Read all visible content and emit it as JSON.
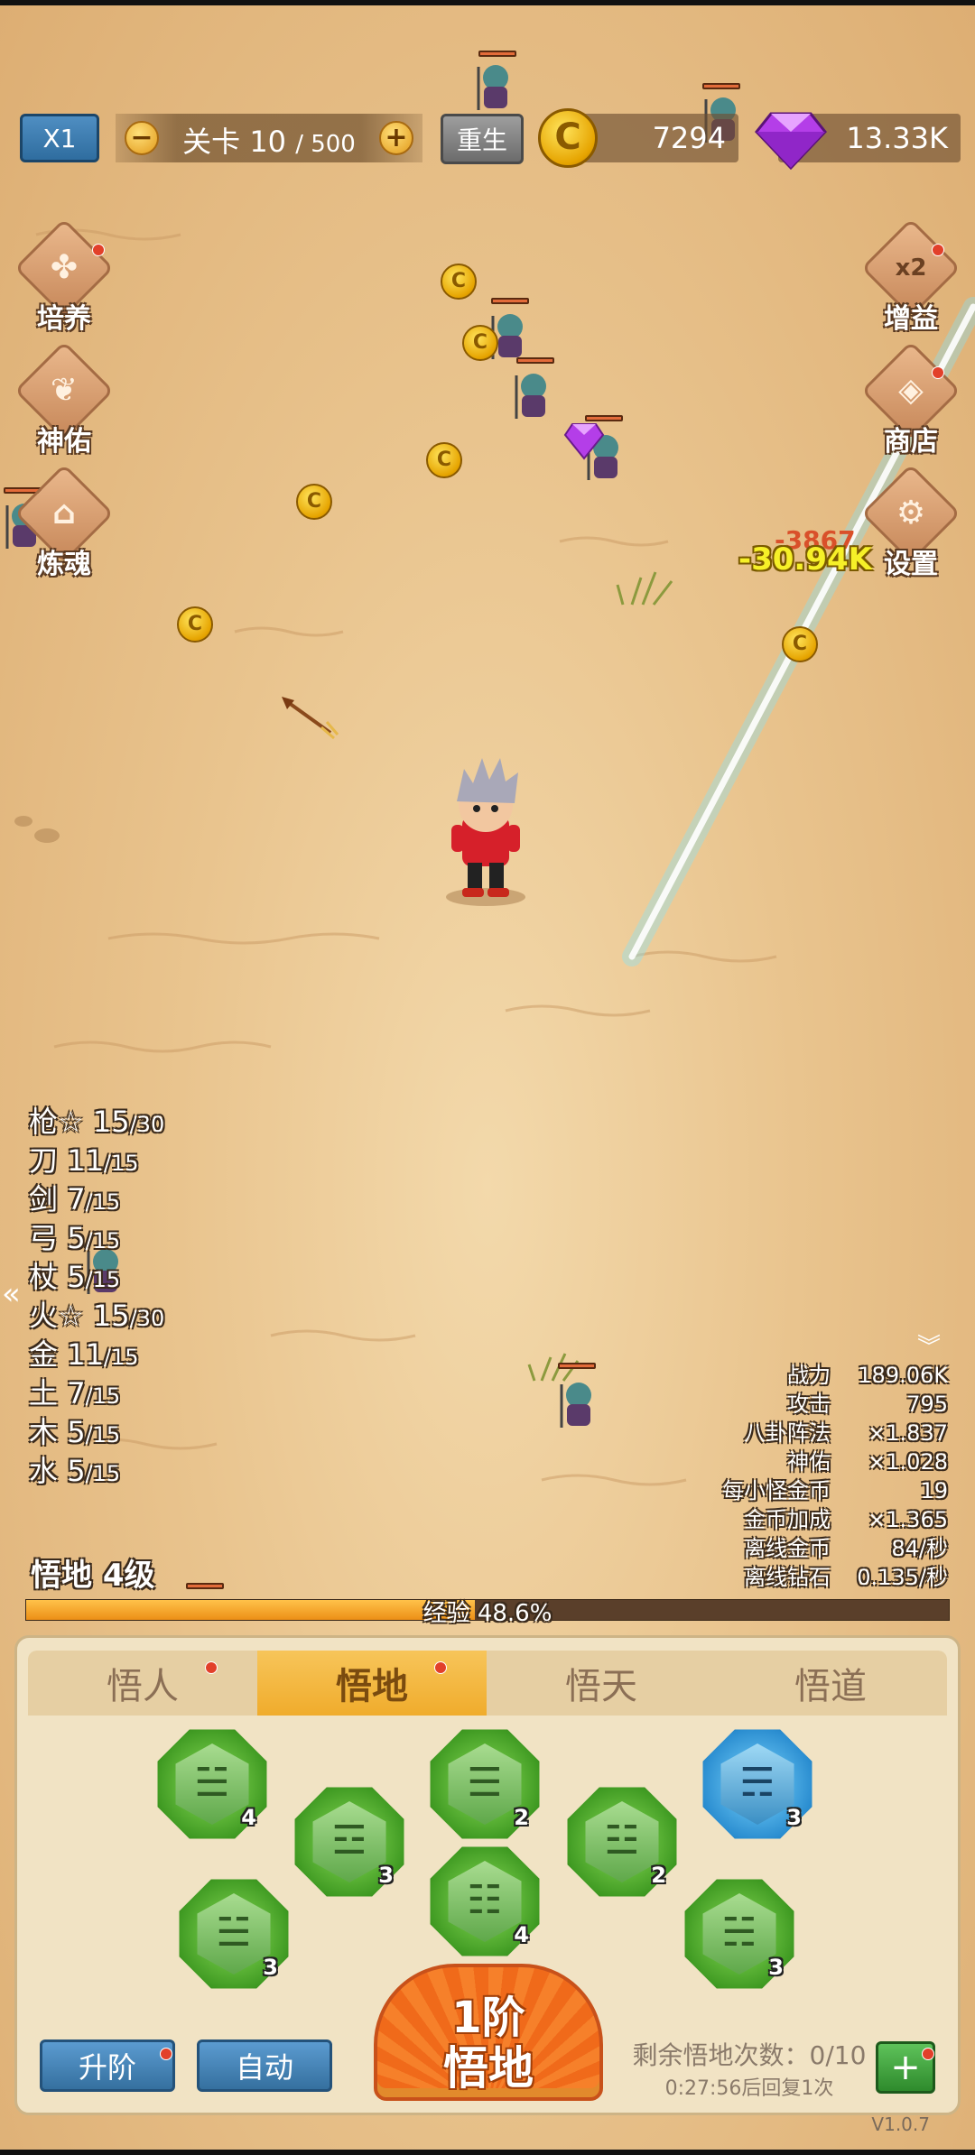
{
  "hud": {
    "speed": "X1",
    "level_label": "关卡",
    "level_current": "10",
    "level_max": "/ 500",
    "minus": "−",
    "plus": "+",
    "rebirth": "重生",
    "coins": "7294",
    "gems": "13.33K",
    "coin_symbol": "C"
  },
  "side_left": [
    {
      "label": "培养",
      "icon": "clover-icon",
      "sym": "✤"
    },
    {
      "label": "神佑",
      "icon": "wings-icon",
      "sym": "❦"
    },
    {
      "label": "炼魂",
      "icon": "house-icon",
      "sym": "⌂"
    }
  ],
  "side_right": [
    {
      "label": "增益",
      "icon": "bag-icon",
      "sym": "x2"
    },
    {
      "label": "商店",
      "icon": "gem-shop-icon",
      "sym": "◈"
    },
    {
      "label": "设置",
      "icon": "gear-icon",
      "sym": "⚙"
    }
  ],
  "damage": {
    "a": "-3867",
    "b": "-30.94K"
  },
  "weapons": [
    {
      "name": "枪☆",
      "cur": "15",
      "max": "/30"
    },
    {
      "name": "刀",
      "cur": "11",
      "max": "/15"
    },
    {
      "name": "剑",
      "cur": "7",
      "max": "/15"
    },
    {
      "name": "弓",
      "cur": "5",
      "max": "/15"
    },
    {
      "name": "杖",
      "cur": "5",
      "max": "/15"
    },
    {
      "name": "火☆",
      "cur": "15",
      "max": "/30"
    },
    {
      "name": "金",
      "cur": "11",
      "max": "/15"
    },
    {
      "name": "土",
      "cur": "7",
      "max": "/15"
    },
    {
      "name": "木",
      "cur": "5",
      "max": "/15"
    },
    {
      "name": "水",
      "cur": "5",
      "max": "/15"
    }
  ],
  "stats": [
    {
      "k": "战力",
      "v": "189.06K"
    },
    {
      "k": "攻击",
      "v": "795"
    },
    {
      "k": "八卦阵法",
      "v": "×1.837"
    },
    {
      "k": "神佑",
      "v": "×1.028"
    },
    {
      "k": "每小怪金币",
      "v": "19"
    },
    {
      "k": "金币加成",
      "v": "×1.365"
    },
    {
      "k": "离线金币",
      "v": "84/秒"
    },
    {
      "k": "离线钻石",
      "v": "0.135/秒"
    }
  ],
  "progress": {
    "level_text": "悟地 4级",
    "exp_text": "经验 48.6%",
    "exp_fraction": 0.486
  },
  "tabs": [
    "悟人",
    "悟地",
    "悟天",
    "悟道"
  ],
  "trigrams": [
    {
      "glyph": "☱",
      "count": "4",
      "color": "green"
    },
    {
      "glyph": "☲",
      "count": "3",
      "color": "green"
    },
    {
      "glyph": "☰",
      "count": "2",
      "color": "green"
    },
    {
      "glyph": "☷",
      "count": "4",
      "color": "green"
    },
    {
      "glyph": "☳",
      "count": "2",
      "color": "green"
    },
    {
      "glyph": "☴",
      "count": "3",
      "color": "blue"
    },
    {
      "glyph": "☱",
      "count": "3",
      "color": "green"
    },
    {
      "glyph": "☵",
      "count": "3",
      "color": "green"
    }
  ],
  "actions": {
    "upgrade": "升阶",
    "auto": "自动",
    "main_line1": "1阶",
    "main_line2": "悟地",
    "remain": "剩余悟地次数：0/10",
    "recover": "0:27:56后回复1次",
    "plus": "+"
  },
  "version": "V1.0.7",
  "colors": {
    "exp_fill": "#ec8f16",
    "tab_active": "#f0ac2c",
    "lightning": "#7fe6ff"
  }
}
